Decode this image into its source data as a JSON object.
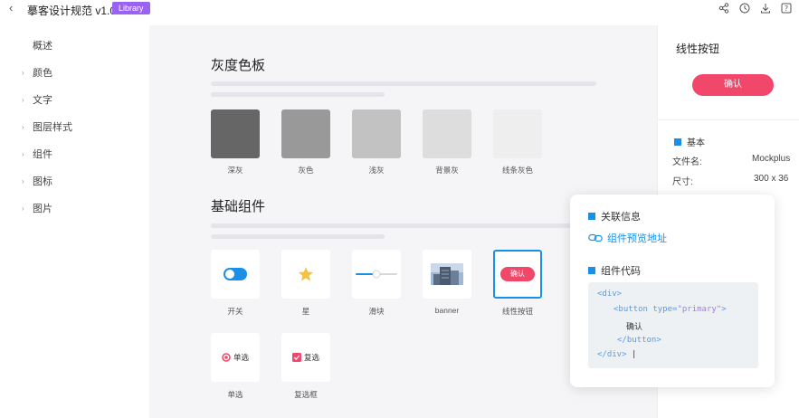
{
  "header": {
    "back_icon": "chevron-left-icon",
    "title": "摹客设计规范 v1.0",
    "badge": "Library",
    "badge_color": "#9a62f2",
    "icons": [
      "share-icon",
      "history-icon",
      "download-icon",
      "help-icon"
    ]
  },
  "sidebar": {
    "items": [
      {
        "label": "概述",
        "expandable": false
      },
      {
        "label": "颜色",
        "expandable": true
      },
      {
        "label": "文字",
        "expandable": true
      },
      {
        "label": "图层样式",
        "expandable": true
      },
      {
        "label": "组件",
        "expandable": true
      },
      {
        "label": "图标",
        "expandable": true
      },
      {
        "label": "图片",
        "expandable": true
      }
    ]
  },
  "main": {
    "gray_section": {
      "title": "灰度色板",
      "swatches": [
        {
          "label": "深灰",
          "color": "#666666"
        },
        {
          "label": "灰色",
          "color": "#999999"
        },
        {
          "label": "浅灰",
          "color": "#c2c2c2"
        },
        {
          "label": "背景灰",
          "color": "#dddddd"
        },
        {
          "label": "线条灰色",
          "color": "#eeeeee"
        }
      ]
    },
    "components_section": {
      "title": "基础组件",
      "tiles": [
        {
          "label": "开关",
          "icon": "toggle-switch-icon"
        },
        {
          "label": "星",
          "icon": "star-icon"
        },
        {
          "label": "滑块",
          "icon": "slider-icon"
        },
        {
          "label": "banner",
          "icon": "building-image-icon"
        },
        {
          "label": "线性按钮",
          "icon": "button-preview-icon",
          "button_text": "确认",
          "selected": true
        },
        {
          "label": "单选",
          "icon": "radio-icon",
          "inner_text": "单选"
        },
        {
          "label": "复选框",
          "icon": "checkbox-icon",
          "inner_text": "复选"
        }
      ]
    }
  },
  "inspector": {
    "title": "线性按钮",
    "button_label": "确认",
    "button_color": "#f0476b",
    "basic_title": "基本",
    "rows": [
      {
        "key": "文件名:",
        "value": "Mockplus"
      },
      {
        "key": "尺寸:",
        "value": "300 x 36"
      }
    ]
  },
  "popup": {
    "related_title": "关联信息",
    "link_label": "组件预览地址",
    "code_title": "组件代码",
    "code": {
      "l1": "<div>",
      "l2_open": "<button type=",
      "l2_value": "\"primary\"",
      "l2_close": ">",
      "l3": "确认",
      "l4": "</button>",
      "l5": "</div>",
      "cursor": "|"
    }
  },
  "accent_color": "#1a8fe8"
}
